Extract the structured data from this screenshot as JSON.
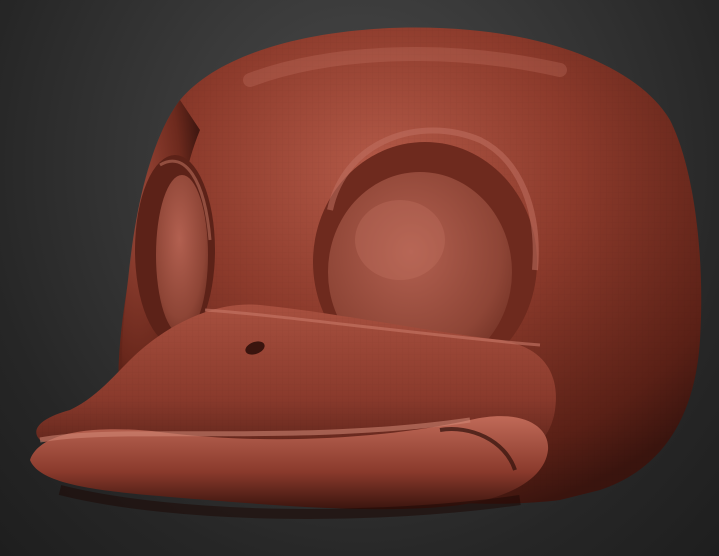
{
  "scene": {
    "subject": "duck-head-sculpt",
    "colors": {
      "background_light": "#4a4a4a",
      "background_dark": "#1e1e1e",
      "clay_base": "#8a3a2c",
      "clay_highlight": "#c46a58",
      "clay_shadow": "#3f1610"
    }
  }
}
